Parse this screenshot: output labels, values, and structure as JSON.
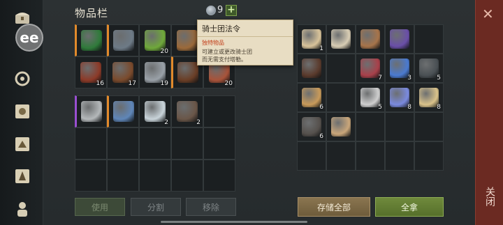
{
  "header": {
    "title": "物品栏",
    "coin_count": "9",
    "plus_label": "+"
  },
  "tooltip": {
    "title": "骑士团法令",
    "type": "独特物品",
    "desc_line1": "可建立或更改骑士团",
    "desc_line2": "而无需支付塔勒。"
  },
  "left_top_slots": [
    {
      "icon": "green-medallion-icon",
      "qty": "",
      "rarity": "orange",
      "color": "#2f7a3a"
    },
    {
      "icon": "knight-helmet-icon",
      "qty": "",
      "rarity": "orange",
      "color": "#6d7a86"
    },
    {
      "icon": "green-potion-icon",
      "qty": "20",
      "rarity": "",
      "color": "#6fa83a"
    },
    {
      "icon": "bronze-key-icon",
      "qty": "",
      "rarity": "",
      "color": "#9c6a3a"
    },
    {
      "icon": "empty",
      "qty": "",
      "rarity": "",
      "color": ""
    },
    {
      "icon": "raw-meat-icon",
      "qty": "16",
      "rarity": "",
      "color": "#8c3a28"
    },
    {
      "icon": "wooden-mug-icon",
      "qty": "17",
      "rarity": "",
      "color": "#7a4a2c"
    },
    {
      "icon": "silver-key-icon",
      "qty": "19",
      "rarity": "",
      "color": "#9aa1a8"
    },
    {
      "icon": "leather-boots-icon",
      "qty": "",
      "rarity": "orange",
      "color": "#6a3e26"
    },
    {
      "icon": "red-key-icon",
      "qty": "20",
      "rarity": "",
      "color": "#a8533a"
    }
  ],
  "left_bottom_slots": [
    {
      "icon": "sickle-icon",
      "qty": "",
      "rarity": "purple",
      "color": "#b4b8ba"
    },
    {
      "icon": "mace-icon",
      "qty": "",
      "rarity": "orange",
      "color": "#5f86b8"
    },
    {
      "icon": "glass-vial-icon",
      "qty": "2",
      "rarity": "",
      "color": "#c9d4da"
    },
    {
      "icon": "leather-pad-icon",
      "qty": "2",
      "rarity": "",
      "color": "#6a5648"
    }
  ],
  "right_slots": [
    {
      "icon": "scroll-sigil-icon",
      "qty": "1",
      "rarity": "",
      "color": "#d8c39a"
    },
    {
      "icon": "bone-icon",
      "qty": "",
      "rarity": "",
      "color": "#d8cdb4"
    },
    {
      "icon": "rope-icon",
      "qty": "",
      "rarity": "",
      "color": "#a7744a"
    },
    {
      "icon": "purple-book-icon",
      "qty": "",
      "rarity": "",
      "color": "#6a4fa8"
    },
    {
      "icon": "empty",
      "qty": "",
      "rarity": "",
      "color": ""
    },
    {
      "icon": "leather-tunic-icon",
      "qty": "",
      "rarity": "",
      "color": "#5a3a2c"
    },
    {
      "icon": "empty",
      "qty": "",
      "rarity": "",
      "color": ""
    },
    {
      "icon": "berries-icon",
      "qty": "7",
      "rarity": "",
      "color": "#a8404a"
    },
    {
      "icon": "blue-orb-icon",
      "qty": "3",
      "rarity": "",
      "color": "#4a7ad0"
    },
    {
      "icon": "iron-bars-icon",
      "qty": "5",
      "rarity": "",
      "color": "#4a5054"
    },
    {
      "icon": "grain-pile-icon",
      "qty": "6",
      "rarity": "",
      "color": "#c89a5a"
    },
    {
      "icon": "empty",
      "qty": "",
      "rarity": "",
      "color": ""
    },
    {
      "icon": "salt-pile-icon",
      "qty": "5",
      "rarity": "",
      "color": "#cfcfcf"
    },
    {
      "icon": "crystal-icon",
      "qty": "8",
      "rarity": "",
      "color": "#7a8adf"
    },
    {
      "icon": "wood-planks-icon",
      "qty": "8",
      "rarity": "",
      "color": "#d9c28a"
    },
    {
      "icon": "iron-ingot-icon",
      "qty": "6",
      "rarity": "",
      "color": "#55504c"
    },
    {
      "icon": "bundle-icon",
      "qty": "",
      "rarity": "",
      "color": "#c9a67a"
    }
  ],
  "buttons": {
    "use": "使用",
    "split": "分割",
    "remove": "移除",
    "store_all": "存储全部",
    "take_all": "全拿"
  },
  "close": {
    "x": "✕",
    "label": "关闭"
  },
  "badge": {
    "text": "ee"
  }
}
